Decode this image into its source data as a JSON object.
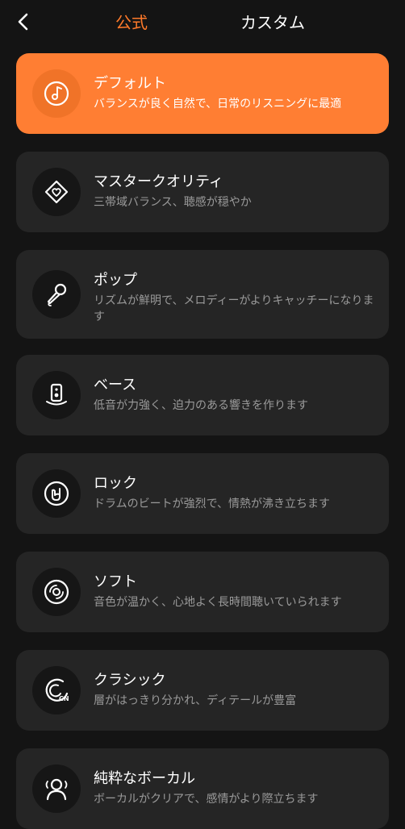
{
  "header": {
    "tab_official": "公式",
    "tab_custom": "カスタム"
  },
  "presets": [
    {
      "title": "デフォルト",
      "desc": "バランスが良く自然で、日常のリスニングに最適",
      "icon": "music-disc-icon",
      "selected": true
    },
    {
      "title": "マスタークオリティ",
      "desc": "三帯域バランス、聴感が穏やか",
      "icon": "heart-diamond-icon",
      "selected": false
    },
    {
      "title": "ポップ",
      "desc": "リズムが鮮明で、メロディーがよりキャッチーになります",
      "icon": "microphone-icon",
      "selected": false
    },
    {
      "title": "ベース",
      "desc": "低音が力強く、迫力のある響きを作ります",
      "icon": "speaker-icon",
      "selected": false
    },
    {
      "title": "ロック",
      "desc": "ドラムのビートが強烈で、情熱が沸き立ちます",
      "icon": "rock-hand-icon",
      "selected": false
    },
    {
      "title": "ソフト",
      "desc": "音色が温かく、心地よく長時間聴いていられます",
      "icon": "vinyl-disc-icon",
      "selected": false
    },
    {
      "title": "クラシック",
      "desc": "層がはっきり分かれ、ディテールが豊富",
      "icon": "classic-cn-icon",
      "selected": false
    },
    {
      "title": "純粋なボーカル",
      "desc": "ボーカルがクリアで、感情がより際立ちます",
      "icon": "vocal-person-icon",
      "selected": false
    }
  ],
  "colors": {
    "accent": "#ff7e33",
    "tab_active": "#ff7a2a",
    "background": "#141414",
    "card": "#252525"
  }
}
